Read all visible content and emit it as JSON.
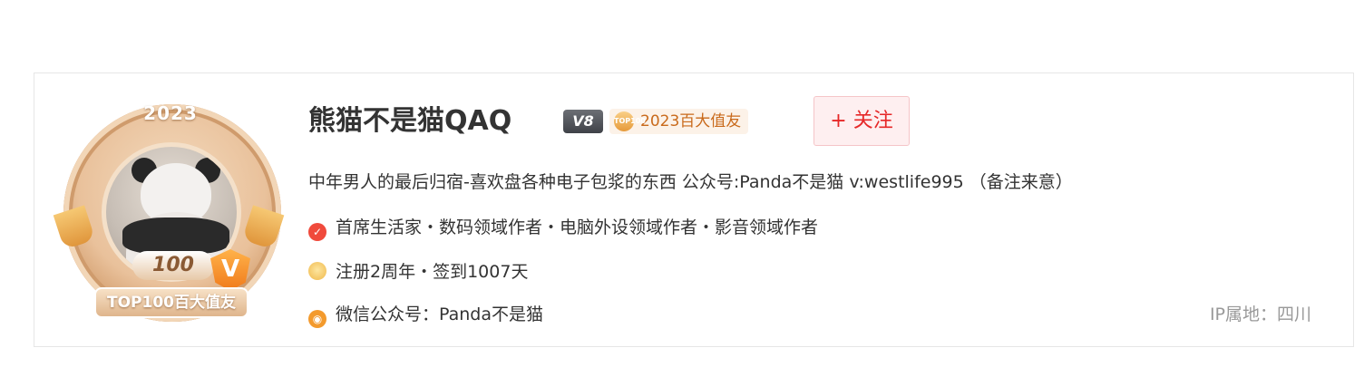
{
  "badge": {
    "year": "2023",
    "hundred": "100",
    "hundred_small": "TOP",
    "v_letter": "V",
    "ribbon_text": "TOP100百大值友"
  },
  "profile": {
    "name": "熊猫不是猫QAQ",
    "level": "V8",
    "honor_tag": "2023百大值友",
    "honor_icon_text": "TOP100",
    "follow_label": "+ 关注",
    "bio": "中年男人的最后归宿-喜欢盘各种电子包浆的东西 公众号:Panda不是猫 v:westlife995 （备注来意）",
    "certifications": "首席生活家・数码领域作者・电脑外设领域作者・影音领域作者",
    "stats": "注册2周年・签到1007天",
    "wechat": "微信公众号：Panda不是猫",
    "ip_location": "IP属地：四川"
  },
  "icons": {
    "cert": "check-badge-icon",
    "medal": "medal-icon",
    "rss": "rss-icon"
  }
}
